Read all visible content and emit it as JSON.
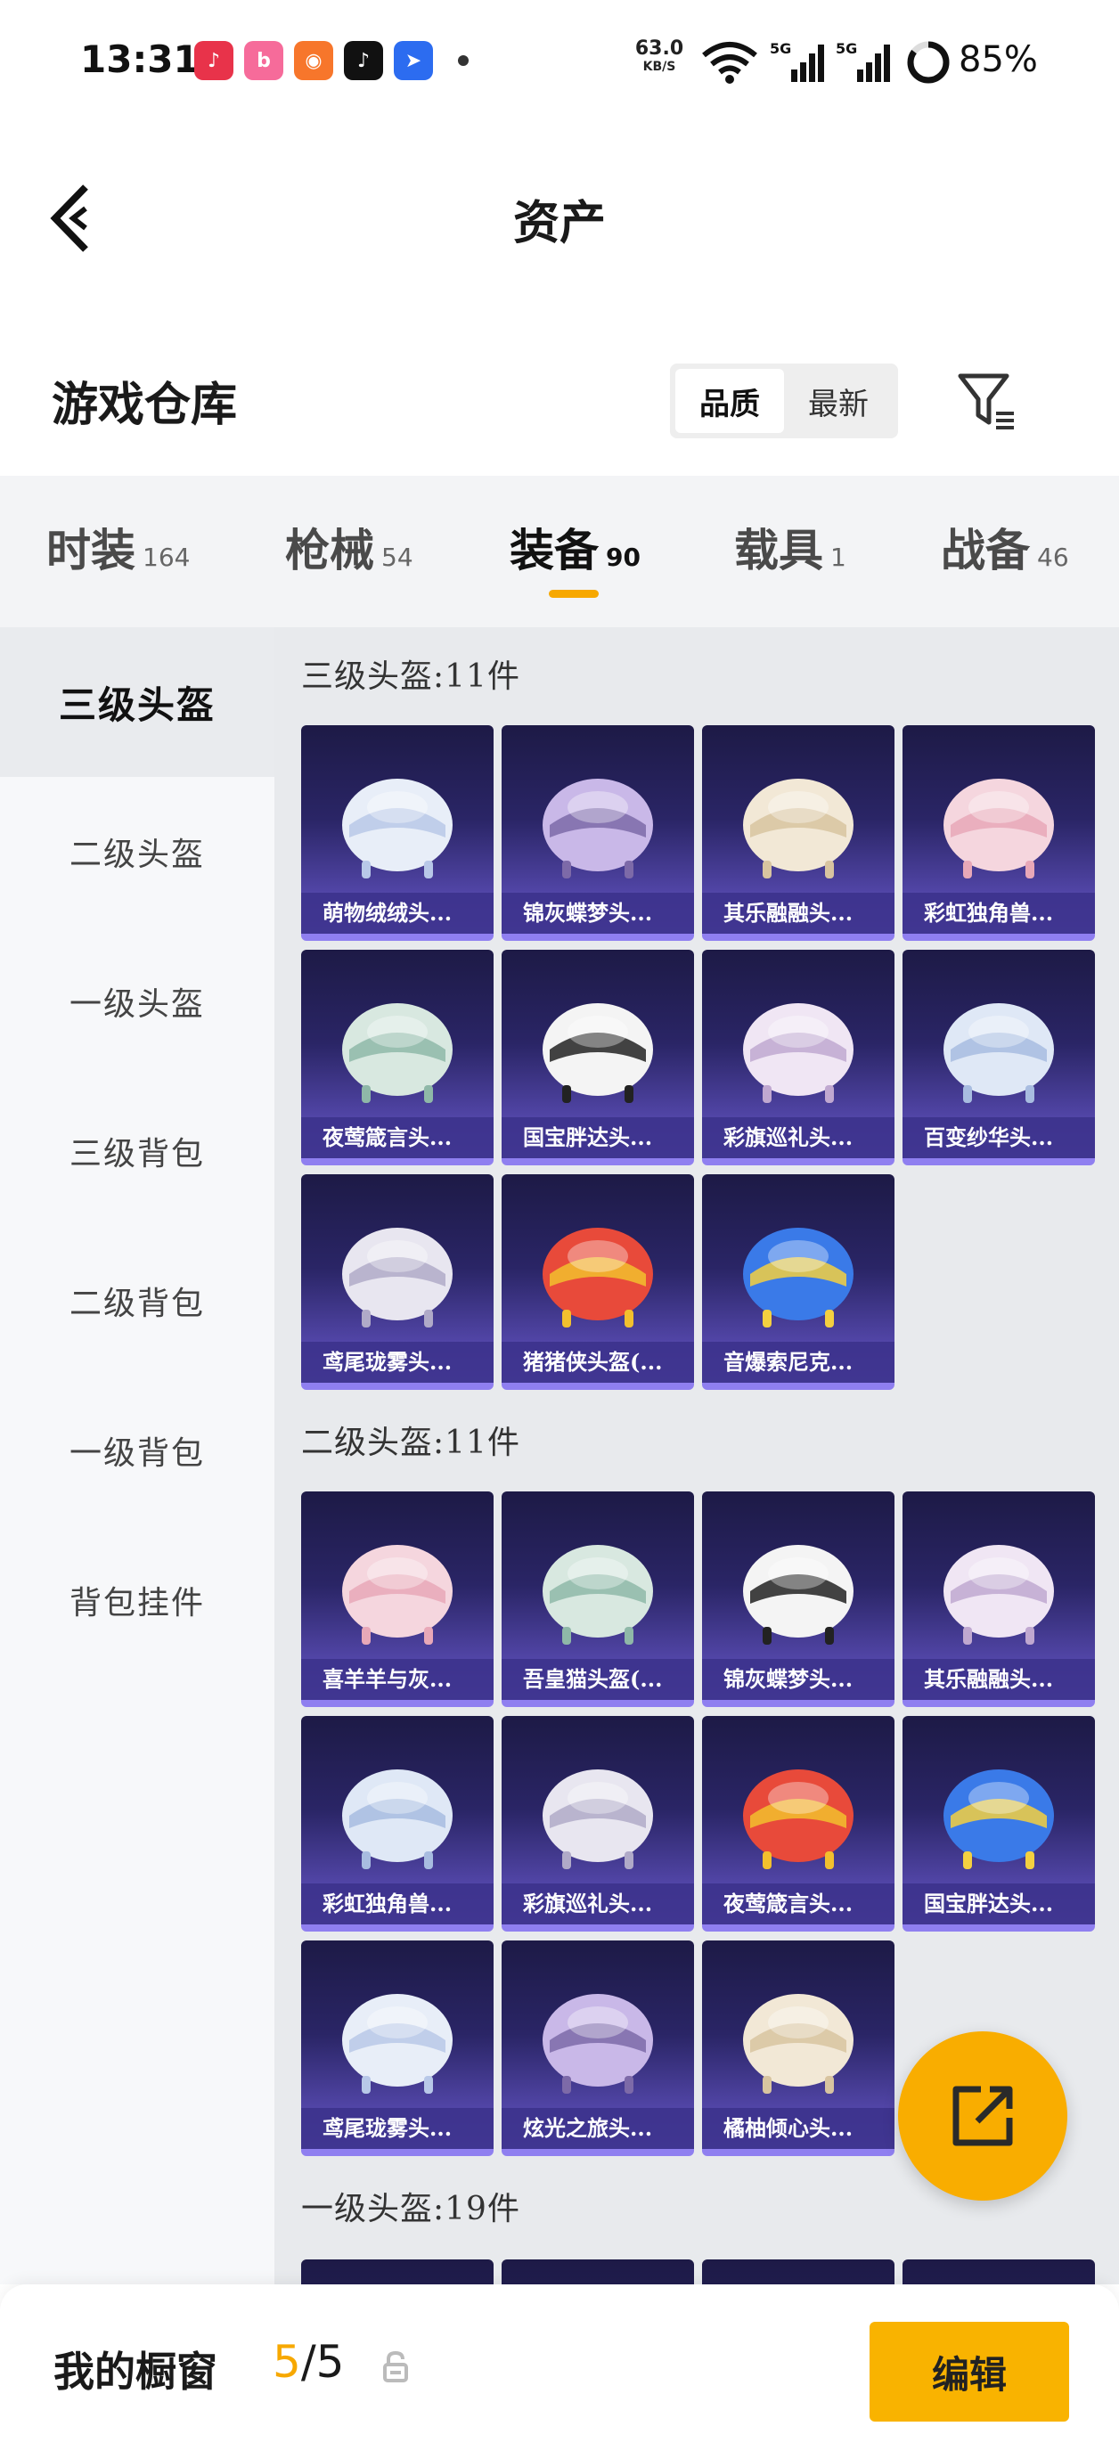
{
  "status_bar": {
    "time": "13:31",
    "net_speed": "63.0",
    "net_unit": "KB/S",
    "battery": "85%",
    "app_icons": [
      "music-app-icon",
      "bilibili-app-icon",
      "kuaishou-app-icon",
      "tiktok-app-icon",
      "feishu-app-icon"
    ]
  },
  "header": {
    "title": "资产"
  },
  "warehouse": {
    "title": "游戏仓库",
    "sort_quality": "品质",
    "sort_newest": "最新",
    "active_sort": "品质"
  },
  "tabs": [
    {
      "label": "时装",
      "count": "164"
    },
    {
      "label": "枪械",
      "count": "54"
    },
    {
      "label": "装备",
      "count": "90"
    },
    {
      "label": "载具",
      "count": "1"
    },
    {
      "label": "战备",
      "count": "46"
    }
  ],
  "active_tab": "装备",
  "sidebar": {
    "items": [
      "三级头盔",
      "二级头盔",
      "一级头盔",
      "三级背包",
      "二级背包",
      "一级背包",
      "背包挂件"
    ],
    "active": "三级头盔"
  },
  "groups": [
    {
      "title": "三级头盔:11件",
      "items": [
        "萌物绒绒头...",
        "锦灰蝶梦头...",
        "其乐融融头...",
        "彩虹独角兽...",
        "夜莺箴言头...",
        "国宝胖达头...",
        "彩旗巡礼头...",
        "百变纱华头...",
        "鸢尾珑雾头...",
        "猪猪侠头盔(...",
        "音爆索尼克..."
      ]
    },
    {
      "title": "二级头盔:11件",
      "items": [
        "喜羊羊与灰...",
        "吾皇猫头盔(...",
        "锦灰蝶梦头...",
        "其乐融融头...",
        "彩虹独角兽...",
        "彩旗巡礼头...",
        "夜莺箴言头...",
        "国宝胖达头...",
        "鸢尾珑雾头...",
        "炫光之旅头...",
        "橘柚倾心头..."
      ]
    },
    {
      "title": "一级头盔:19件",
      "items": []
    }
  ],
  "bottom_bar": {
    "label": "我的橱窗",
    "current": "5",
    "total": "/5",
    "edit_label": "编辑"
  },
  "colors": {
    "accent": "#f9b300",
    "card_top": "#1d1a46",
    "card_bottom": "#6a5cc4"
  }
}
